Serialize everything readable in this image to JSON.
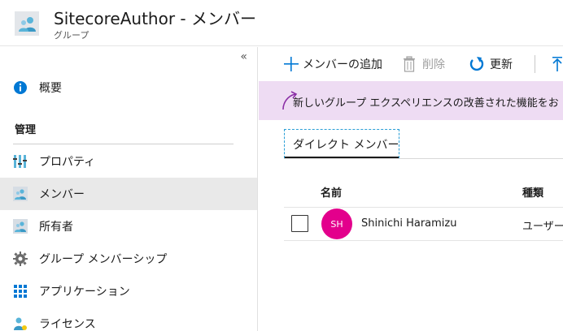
{
  "header": {
    "title": "SitecoreAuthor - メンバー",
    "subtitle": "グループ"
  },
  "sidebar": {
    "collapse_label": "«",
    "overview": "概要",
    "section_manage": "管理",
    "items": [
      {
        "label": "プロパティ"
      },
      {
        "label": "メンバー"
      },
      {
        "label": "所有者"
      },
      {
        "label": "グループ メンバーシップ"
      },
      {
        "label": "アプリケーション"
      },
      {
        "label": "ライセンス"
      }
    ]
  },
  "toolbar": {
    "add_members": "メンバーの追加",
    "delete": "削除",
    "refresh": "更新"
  },
  "banner": {
    "text": "新しいグループ エクスペリエンスの改善された機能をお"
  },
  "tabs": {
    "direct_members": "ダイレクト メンバー"
  },
  "table": {
    "columns": [
      "名前",
      "種類"
    ],
    "rows": [
      {
        "initials": "SH",
        "name": "Shinichi Haramizu",
        "type": "ユーザー"
      }
    ]
  },
  "colors": {
    "accent": "#0078d4",
    "banner_bg": "#eedcf3",
    "avatar_bg": "#e3008c",
    "active_item_bg": "#e9e9e9"
  }
}
